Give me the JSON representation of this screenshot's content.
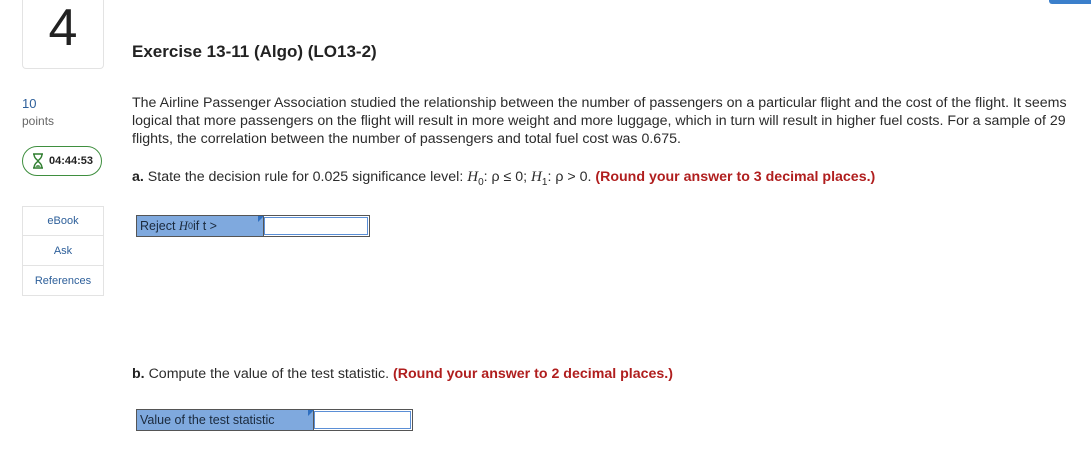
{
  "question": {
    "number": "4",
    "points_value": "10",
    "points_label": "points",
    "timer": "04:44:53"
  },
  "side_links": [
    {
      "label": "eBook"
    },
    {
      "label": "Ask"
    },
    {
      "label": "References"
    }
  ],
  "exercise": {
    "title": "Exercise 13-11 (Algo) (LO13-2)",
    "stem": "The Airline Passenger Association studied the relationship between the number of passengers on a particular flight and the cost of the flight. It seems logical that more passengers on the flight will result in more weight and more luggage, which in turn will result in higher fuel costs. For a sample of 29 flights, the correlation between the number of passengers and total fuel cost was 0.675."
  },
  "part_a": {
    "letter": "a.",
    "text": "State the decision rule for 0.025 significance level:",
    "h0_symbol": "H",
    "h0_sub": "0",
    "h0_cond": ": ρ ≤ 0;",
    "h1_symbol": "H",
    "h1_sub": "1",
    "h1_cond": ": ρ > 0.",
    "hint": "(Round your answer to 3 decimal places.)",
    "answer_label_prefix": "Reject ",
    "answer_label_h": "H",
    "answer_label_sub": "0",
    "answer_label_suffix": " if t >",
    "answer_value": ""
  },
  "part_b": {
    "letter": "b.",
    "text": "Compute the value of the test statistic.",
    "hint": "(Round your answer to 2 decimal places.)",
    "answer_label": "Value of the test statistic",
    "answer_value": ""
  }
}
